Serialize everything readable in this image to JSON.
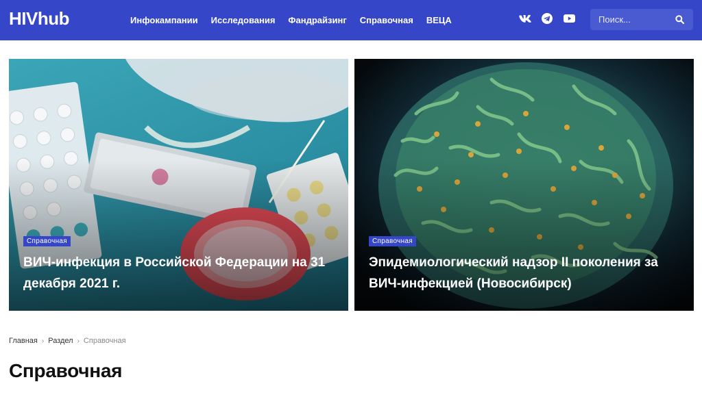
{
  "header": {
    "logo": "HIVhub",
    "nav": [
      "Инфокампании",
      "Исследования",
      "Фандрайзинг",
      "Справочная",
      "ВЕЦА"
    ],
    "social_icons": [
      "vk-icon",
      "telegram-icon",
      "youtube-icon"
    ],
    "search": {
      "placeholder": "Поиск..."
    },
    "colors": {
      "bar": "#3547c8",
      "search_bg": "#4a5bd1"
    }
  },
  "cards": [
    {
      "category": "Справочная",
      "title": "ВИЧ-инфекция в Российской Федерации на 31 декабря 2021 г."
    },
    {
      "category": "Справочная",
      "title": "Эпидемиологический надзор II поколения за ВИЧ-инфекцией (Новосибирск)"
    }
  ],
  "breadcrumb": [
    "Главная",
    "Раздел",
    "Справочная"
  ],
  "page_title": "Справочная"
}
